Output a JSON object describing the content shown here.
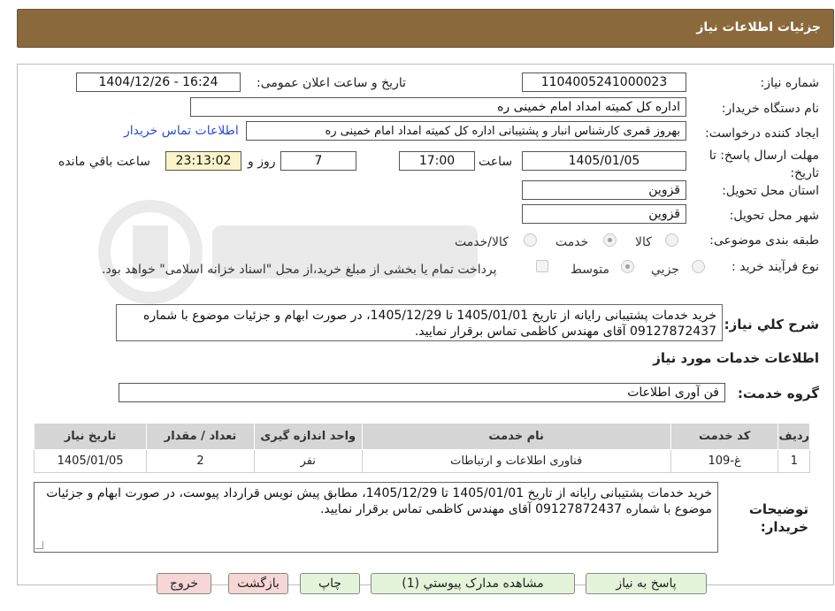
{
  "header": {
    "title": "جزئیات اطلاعات نیاز"
  },
  "form": {
    "need_number_label": "شماره نیاز:",
    "need_number": "1104005241000023",
    "announce_label": "تاریخ و ساعت اعلان عمومی:",
    "announce_value": "1404/12/26 - 16:24",
    "buyer_org_label": "نام دستگاه خریدار:",
    "buyer_org": "اداره کل کمیته امداد امام خمینی  ره",
    "creator_label": "ایجاد کننده درخواست:",
    "creator": "بهروز قمری کارشناس انبار و پشتیبانی اداره کل کمیته امداد امام خمینی  ره",
    "contact_link": "اطلاعات تماس خریدار",
    "deadline_label": "مهلت ارسال پاسخ: تا تاریخ:",
    "deadline_date": "1405/01/05",
    "time_label": "ساعت",
    "deadline_time": "17:00",
    "days": "7",
    "days_label": "روز و",
    "remaining": "23:13:02",
    "remaining_label": "ساعت باقي مانده",
    "province_label": "استان محل تحویل:",
    "province": "قزوین",
    "city_label": "شهر محل تحویل:",
    "city": "قزوین",
    "category_label": "طبقه بندی موضوعی:",
    "category_options": [
      "کالا",
      "خدمت",
      "کالا/خدمت"
    ],
    "process_label": "نوع فرآیند خرید :",
    "process_options": [
      "جزيي",
      "متوسط"
    ],
    "payment_note": "پرداخت تمام یا بخشی از مبلغ خرید،از محل \"اسناد خزانه اسلامی\" خواهد بود."
  },
  "description": {
    "label": "شرح کلي نياز:",
    "text": "خرید خدمات پشتیبانی رایانه از تاریخ 1405/01/01 تا 1405/12/29، در صورت ابهام و جزئیات موضوع با شماره 09127872437 آقای مهندس کاظمی تماس برقرار نمایید."
  },
  "services": {
    "title": "اطلاعات خدمات مورد نیاز",
    "group_label": "گروه خدمت:",
    "group_value": "فن آوری اطلاعات",
    "columns": [
      "ردیف",
      "کد خدمت",
      "نام خدمت",
      "واحد اندازه گیری",
      "تعداد / مقدار",
      "تاریخ نیاز"
    ],
    "rows": [
      [
        "1",
        "غ-109",
        "فناوری اطلاعات و ارتباطات",
        "نفر",
        "2",
        "1405/01/05"
      ]
    ]
  },
  "buyer_notes": {
    "label": "توضیحات خریدار:",
    "text": "خرید خدمات پشتیبانی رایانه از تاریخ 1405/01/01 تا 1405/12/29، مطابق پیش نویس قرارداد پیوست، در صورت ابهام و جزئیات موضوع با شماره 09127872437 آقای مهندس کاظمی تماس برقرار نمایید."
  },
  "buttons": {
    "reply": "پاسخ به نیاز",
    "attachments": "مشاهده مدارک پیوستي (1)",
    "print": "چاپ",
    "back": "بازگشت",
    "exit": "خروج"
  },
  "colors": {
    "header_bg": "#8a6a3c",
    "green_btn": "#e4f4da",
    "pink_btn": "#f7d6d6",
    "link": "#2a4fd1"
  }
}
